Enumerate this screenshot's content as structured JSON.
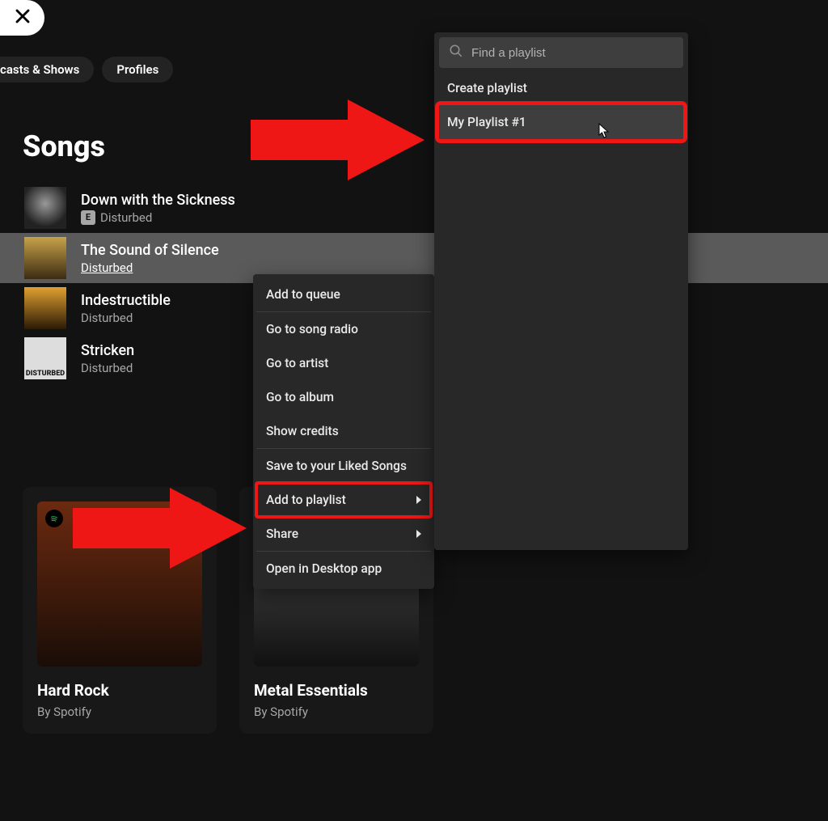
{
  "chips": {
    "podcasts": "casts & Shows",
    "profiles": "Profiles"
  },
  "heading": "Songs",
  "songs": [
    {
      "title": "Down with the Sickness",
      "artist": "Disturbed",
      "explicit": true
    },
    {
      "title": "The Sound of Silence",
      "artist": "Disturbed",
      "explicit": false
    },
    {
      "title": "Indestructible",
      "artist": "Disturbed",
      "explicit": false
    },
    {
      "title": "Stricken",
      "artist": "Disturbed",
      "explicit": false
    }
  ],
  "cards": [
    {
      "title": "Hard Rock",
      "sub": "By Spotify"
    },
    {
      "title": "Metal Essentials",
      "sub": "By Spotify"
    }
  ],
  "context_menu": {
    "add_to_queue": "Add to queue",
    "go_to_song_radio": "Go to song radio",
    "go_to_artist": "Go to artist",
    "go_to_album": "Go to album",
    "show_credits": "Show credits",
    "save_liked": "Save to your Liked Songs",
    "add_to_playlist": "Add to playlist",
    "share": "Share",
    "open_desktop": "Open in Desktop app"
  },
  "submenu": {
    "search_placeholder": "Find a playlist",
    "create": "Create playlist",
    "playlist1": "My Playlist #1"
  },
  "explicit_label": "E",
  "album4_label": "DISTURBED"
}
